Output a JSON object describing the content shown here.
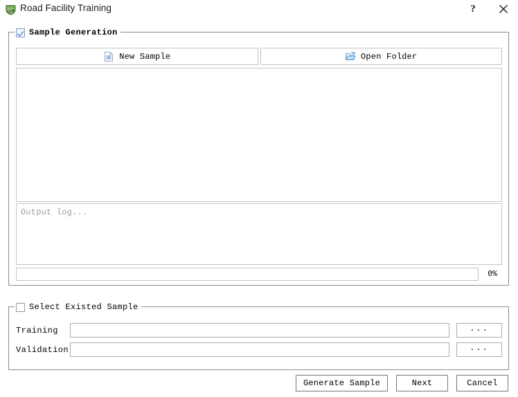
{
  "window": {
    "title": "Road Facility Training",
    "app_icon": "road-shield-icon",
    "help_label": "?",
    "close_label": "close-icon"
  },
  "sample_generation": {
    "legend": "Sample Generation",
    "checked": true,
    "toolbar": {
      "new_sample": {
        "label": "New Sample",
        "icon": "new-document-icon"
      },
      "open_folder": {
        "label": "Open Folder",
        "icon": "open-folder-icon"
      }
    },
    "sample_list": {
      "items": []
    },
    "log": {
      "placeholder": "Output log...",
      "text": ""
    },
    "progress": {
      "percent_label": "0%",
      "value": 0
    }
  },
  "select_existed_sample": {
    "legend": "Select Existed Sample",
    "checked": false,
    "fields": [
      {
        "label": "Training",
        "value": "",
        "browse_label": "..."
      },
      {
        "label": "Validation",
        "value": "",
        "browse_label": "..."
      }
    ]
  },
  "footer": {
    "generate_sample": "Generate Sample",
    "next": "Next",
    "cancel": "Cancel"
  },
  "colors": {
    "accent": "#3ea7df",
    "border": "#8c8c8c",
    "field_border": "#acacac",
    "placeholder": "#9d9d9d"
  }
}
